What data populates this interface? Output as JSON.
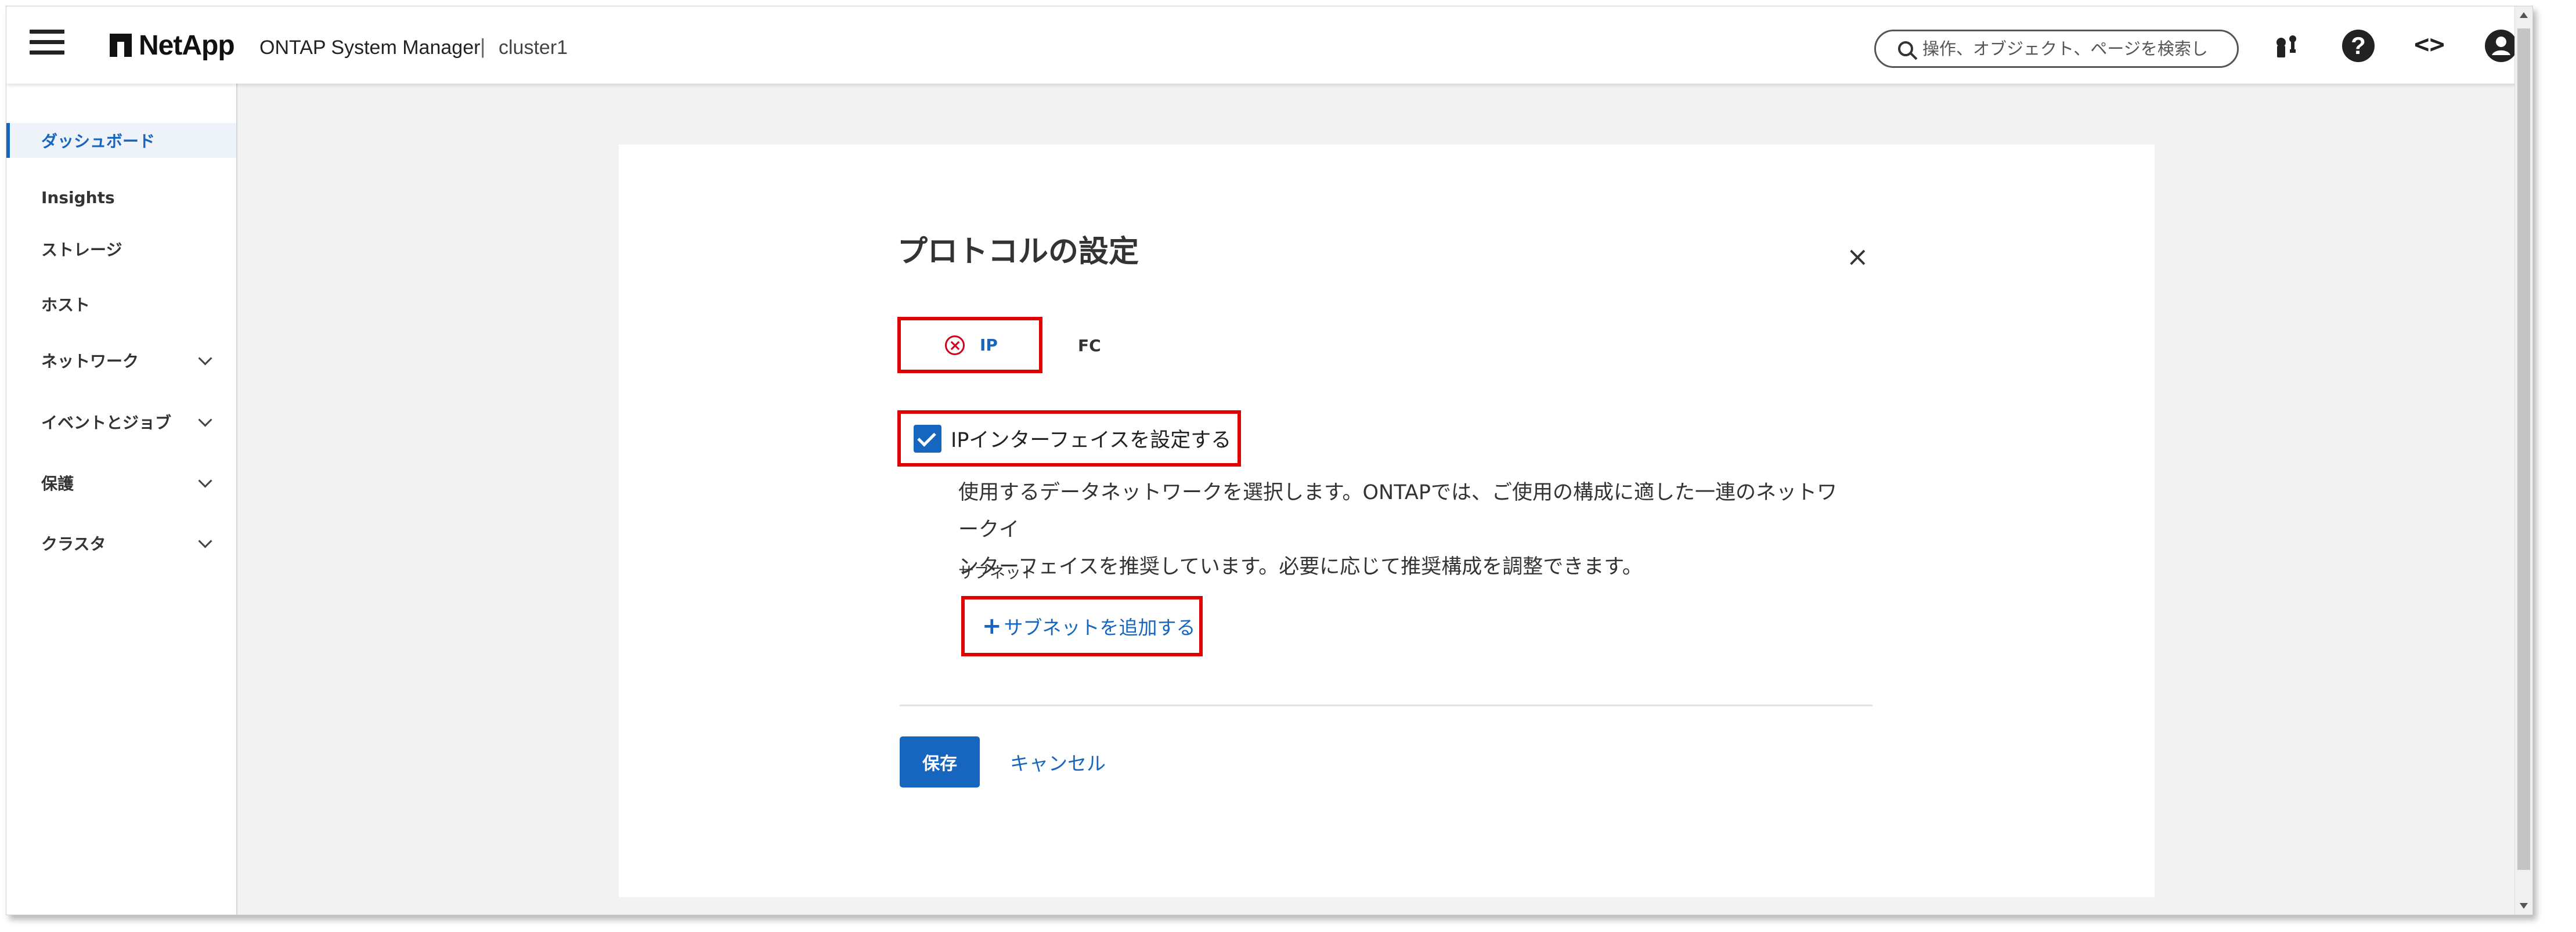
{
  "header": {
    "logo_text": "NetApp",
    "app_name": "ONTAP System Manager",
    "separator": "|",
    "cluster_name": "cluster1",
    "search_placeholder": "操作、オブジェクト、ページを検索し",
    "icons": [
      "menu-icon",
      "key-icon",
      "help-icon",
      "code-icon",
      "user-icon"
    ]
  },
  "sidebar": {
    "items": [
      {
        "label": "ダッシュボード",
        "active": true
      },
      {
        "label": "Insights"
      },
      {
        "label": "ストレージ"
      },
      {
        "label": "ホスト"
      },
      {
        "label": "ネットワーク",
        "expandable": true
      },
      {
        "label": "イベントとジョブ",
        "expandable": true
      },
      {
        "label": "保護",
        "expandable": true
      },
      {
        "label": "クラスタ",
        "expandable": true
      }
    ]
  },
  "dialog": {
    "title": "プロトコルの設定",
    "close_symbol": "×",
    "tabs": [
      {
        "label": "IP",
        "status": "error",
        "active": true
      },
      {
        "label": "FC"
      }
    ],
    "configure_ip_checkbox": {
      "label": "IPインターフェイスを設定する",
      "checked": true
    },
    "description_line1": "使用するデータネットワークを選択します。ONTAPでは、ご使用の構成に適した一連のネットワークイ",
    "description_line2": "ンターフェイスを推奨しています。必要に応じて推奨構成を調整できます。",
    "subnet_label": "サブネット",
    "add_subnet_plus": "+",
    "add_subnet_label": "サブネットを追加する",
    "save_label": "保存",
    "cancel_label": "キャンセル"
  },
  "colors": {
    "accent": "#1666c0",
    "highlight": "#e00000",
    "error": "#d0021b"
  }
}
